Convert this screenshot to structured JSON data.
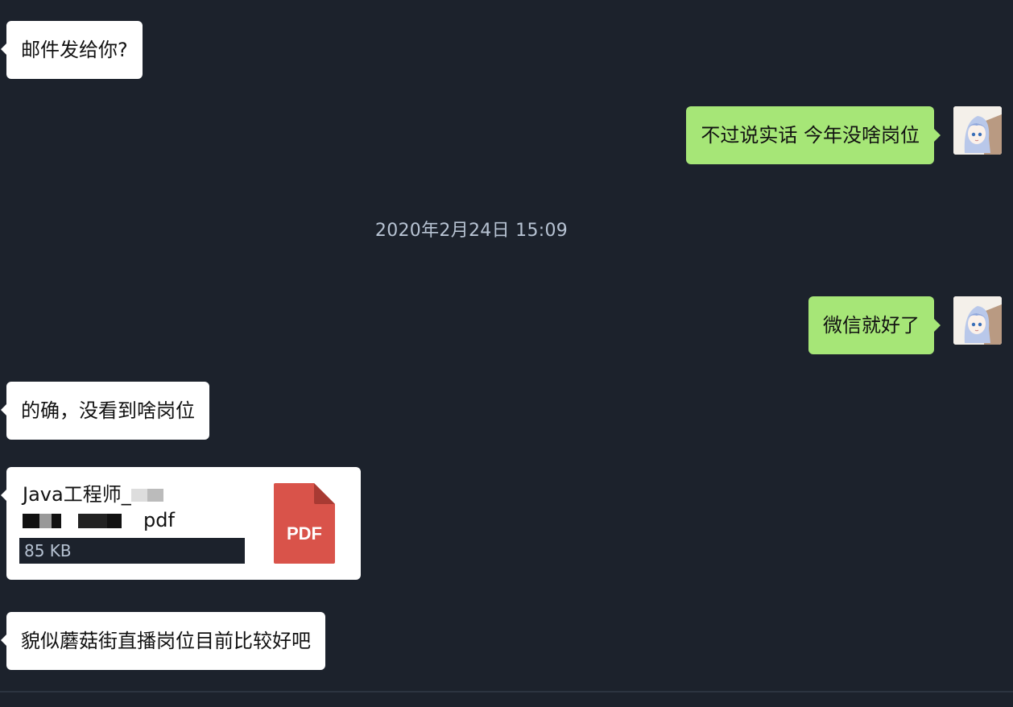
{
  "messages": [
    {
      "side": "in",
      "text": "邮件发给你?"
    },
    {
      "side": "out",
      "text": "不过说实话 今年没啥岗位"
    },
    {
      "side": "out",
      "text": "微信就好了"
    },
    {
      "side": "in",
      "text": "的确，没看到啥岗位"
    },
    {
      "side": "in",
      "text": "貌似蘑菇街直播岗位目前比较好吧"
    }
  ],
  "timestamp": "2020年2月24日 15:09",
  "file": {
    "name_prefix": "Java工程师_",
    "name_line2_suffix": "pdf",
    "size": "85 KB",
    "icon_label": "PDF",
    "icon": "pdf-file-icon"
  },
  "avatar": {
    "icon": "user-avatar"
  },
  "colors": {
    "background": "#1c222c",
    "incoming_bubble": "#ffffff",
    "outgoing_bubble": "#a6e677",
    "timestamp_text": "#b7c3d3",
    "pdf_red": "#d9534a"
  }
}
